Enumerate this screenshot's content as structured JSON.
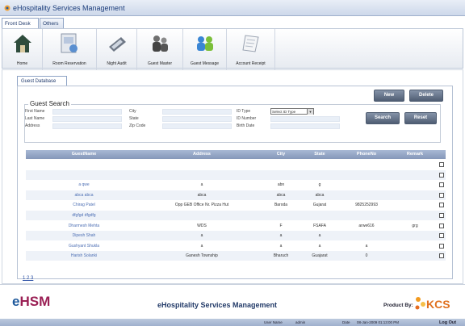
{
  "window": {
    "title": "eHospitality Services Management"
  },
  "tabs": [
    {
      "label": "Front Desk"
    },
    {
      "label": "Others"
    }
  ],
  "toolbar": [
    {
      "label": "Home",
      "icon": "home-icon"
    },
    {
      "label": "Room Reservation",
      "icon": "room-reservation-icon"
    },
    {
      "label": "Night Audit",
      "icon": "calculator-icon"
    },
    {
      "label": "Guest Master",
      "icon": "guests-icon"
    },
    {
      "label": "Guest Message",
      "icon": "guest-message-icon"
    },
    {
      "label": "Account Receipt",
      "icon": "receipt-icon"
    }
  ],
  "page_tab": "Guest Database",
  "actions": {
    "new": "New",
    "delete": "Delete"
  },
  "search": {
    "legend": "Guest Search",
    "first_name": "First Name",
    "last_name": "Last Name",
    "address": "Address",
    "city": "City",
    "state": "State",
    "zip_code": "Zip Code",
    "id_type": "ID Type",
    "id_type_value": "Select ID Type",
    "id_number": "ID Number",
    "birth_date": "Birth Date",
    "search_button": "Search",
    "reset_button": "Reset"
  },
  "grid": {
    "headers": [
      "GuestName",
      "Address",
      "City",
      "State",
      "PhoneNo",
      "Remark"
    ],
    "rows": [
      [
        "",
        "",
        "",
        "",
        "",
        ""
      ],
      [
        "",
        "",
        "",
        "",
        "",
        ""
      ],
      [
        "a qwe",
        "a",
        "abn",
        "g",
        "",
        ""
      ],
      [
        "abca abca",
        "abca",
        "abca",
        "abca",
        "",
        ""
      ],
      [
        "Chirag Patel",
        "Opp GEB Office Nr. Pizza Hut",
        "Baroda",
        "Gujarat",
        "9825252993",
        ""
      ],
      [
        "dfgfgd dfgdfg",
        "",
        "",
        "",
        "",
        ""
      ],
      [
        "Dharmesh Mehta",
        "WDS",
        "F",
        "FSAFA",
        "arwe616",
        "grg"
      ],
      [
        "Dipesh Shah",
        "a",
        "a",
        "a",
        "",
        ""
      ],
      [
        "Gushyant Shukla",
        "a",
        "a",
        "a",
        "a",
        ""
      ],
      [
        "Harish Solanki",
        "Ganesh Township",
        "Bharuch",
        "Guajarat",
        "0",
        ""
      ]
    ]
  },
  "pager": "1 2 3",
  "footer": {
    "logo_prefix": "e",
    "logo_rest": "HSM",
    "title": "eHospitality Services Management",
    "product_by": "Product By:",
    "kcs": "KCS"
  },
  "status": {
    "user_label": "User Name",
    "user_value": "admin",
    "date_label": "Date",
    "date_value": "08-Jan-2009 01:13:00 PM",
    "logout": "Log Out"
  }
}
